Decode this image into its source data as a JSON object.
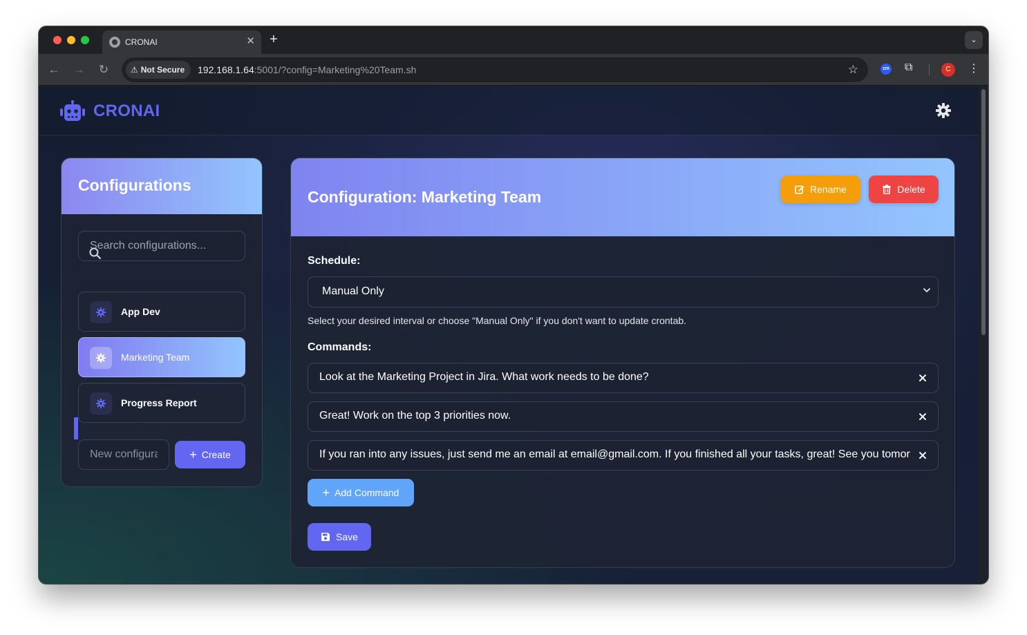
{
  "browser": {
    "tab_title": "CRONAI",
    "security_label": "Not Secure",
    "url_host": "192.168.1.64",
    "url_rest": ":5001/?config=Marketing%20Team.sh",
    "extension_label": "zm",
    "profile_initial": "C"
  },
  "app": {
    "brand": "CRONAI",
    "accent_color": "#6366f1"
  },
  "sidebar": {
    "title": "Configurations",
    "search_placeholder": "Search configurations...",
    "items": [
      {
        "label": "App Dev",
        "active": false
      },
      {
        "label": "Marketing Team",
        "active": true
      },
      {
        "label": "Progress Report",
        "active": false
      }
    ],
    "new_placeholder": "New configuration name",
    "create_label": "Create"
  },
  "main": {
    "title": "Configuration: Marketing Team",
    "rename_label": "Rename",
    "delete_label": "Delete",
    "schedule_label": "Schedule:",
    "schedule_value": "Manual Only",
    "schedule_help": "Select your desired interval or choose \"Manual Only\" if you don't want to update crontab.",
    "commands_label": "Commands:",
    "commands": [
      "Look at the Marketing Project in Jira. What work needs to be done?",
      "Great! Work on the top 3 priorities now.",
      "If you ran into any issues, just send me an email at email@gmail.com. If you finished all your tasks, great! See you tomorrow!"
    ],
    "add_command_label": "Add Command",
    "save_label": "Save"
  }
}
